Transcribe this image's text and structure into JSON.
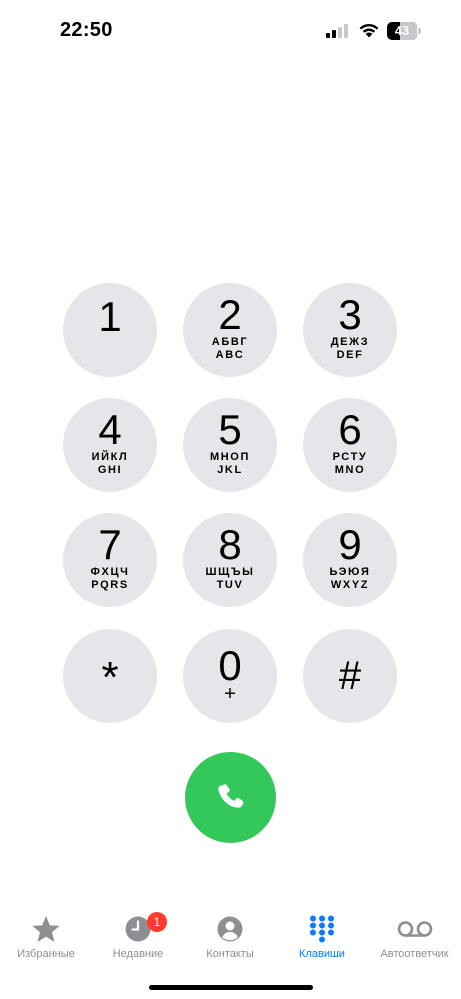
{
  "status_bar": {
    "time": "22:50",
    "battery_level": "43",
    "battery_fraction": 0.43,
    "signal_bars_filled": 2,
    "signal_bars_total": 4
  },
  "keypad": {
    "keys": [
      {
        "digit": "1",
        "letters_ru": "",
        "letters_en": ""
      },
      {
        "digit": "2",
        "letters_ru": "АБВГ",
        "letters_en": "ABC"
      },
      {
        "digit": "3",
        "letters_ru": "ДЕЖЗ",
        "letters_en": "DEF"
      },
      {
        "digit": "4",
        "letters_ru": "ИЙКЛ",
        "letters_en": "GHI"
      },
      {
        "digit": "5",
        "letters_ru": "МНОП",
        "letters_en": "JKL"
      },
      {
        "digit": "6",
        "letters_ru": "РСТУ",
        "letters_en": "MNO"
      },
      {
        "digit": "7",
        "letters_ru": "ФХЦЧ",
        "letters_en": "PQRS"
      },
      {
        "digit": "8",
        "letters_ru": "ШЩЪЫ",
        "letters_en": "TUV"
      },
      {
        "digit": "9",
        "letters_ru": "ЬЭЮЯ",
        "letters_en": "WXYZ"
      },
      {
        "digit": "*",
        "letters_ru": "",
        "letters_en": ""
      },
      {
        "digit": "0",
        "letters_ru": "+",
        "letters_en": ""
      },
      {
        "digit": "#",
        "letters_ru": "",
        "letters_en": ""
      }
    ]
  },
  "call_button": {
    "icon": "phone-icon",
    "color": "#34c759"
  },
  "tab_bar": {
    "accent_color": "#0a7aff",
    "inactive_color": "#8e8e93",
    "tabs": [
      {
        "label": "Избранные",
        "icon": "star-icon"
      },
      {
        "label": "Недавние",
        "icon": "clock-icon",
        "badge": "1"
      },
      {
        "label": "Контакты",
        "icon": "person-icon"
      },
      {
        "label": "Клавиши",
        "icon": "keypad-icon",
        "active": true
      },
      {
        "label": "Автоответчик",
        "icon": "voicemail-icon"
      }
    ]
  }
}
